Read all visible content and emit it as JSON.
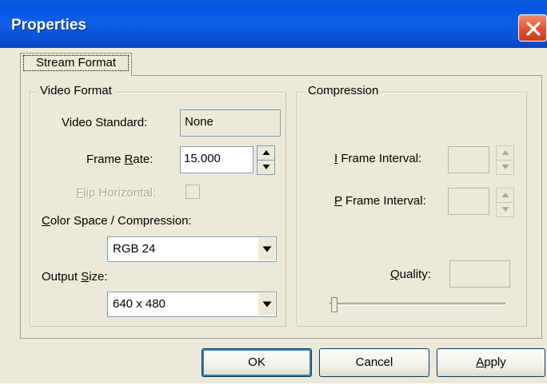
{
  "window": {
    "title": "Properties"
  },
  "tabs": [
    {
      "label": "Stream Format"
    }
  ],
  "video_format": {
    "title": "Video Format",
    "standard_label": "Video Standard:",
    "standard_value": "None",
    "frame_rate_pre": "Frame ",
    "frame_rate_mn": "R",
    "frame_rate_post": "ate:",
    "frame_rate_value": "15.000",
    "flip_mn": "F",
    "flip_post": "lip Horizontal:",
    "color_mn": "C",
    "color_post": "olor Space / Compression:",
    "color_value": "RGB 24",
    "output_pre": "Output ",
    "output_mn": "S",
    "output_post": "ize:",
    "output_value": "640 x 480"
  },
  "compression": {
    "title": "Compression",
    "iframe_mn": "I",
    "iframe_post": " Frame Interval:",
    "pframe_mn": "P",
    "pframe_post": " Frame Interval:",
    "quality_mn": "Q",
    "quality_post": "uality:",
    "quality_level": 0
  },
  "buttons": {
    "ok": "OK",
    "cancel": "Cancel",
    "apply_mn": "A",
    "apply_post": "pply"
  }
}
